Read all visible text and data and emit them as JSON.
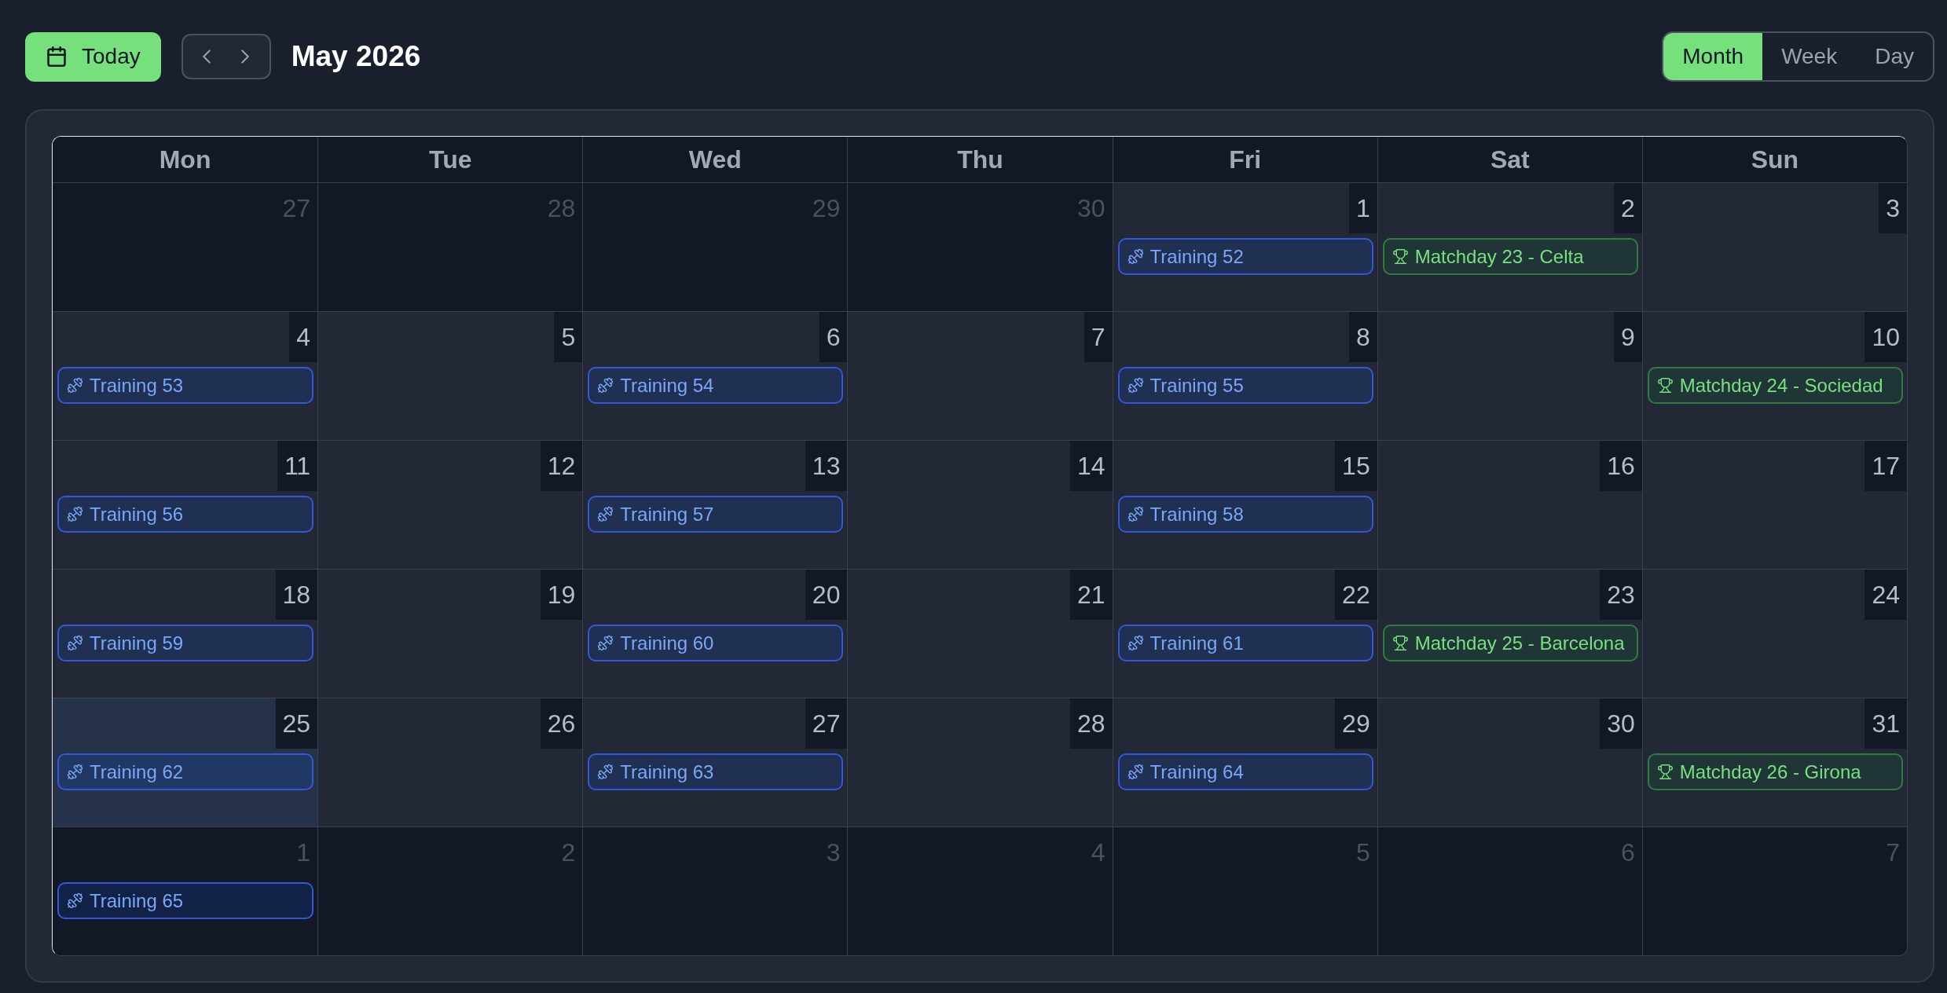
{
  "toolbar": {
    "today_button": "Today",
    "title": "May 2026",
    "views": [
      {
        "label": "Month",
        "selected": true
      },
      {
        "label": "Week",
        "selected": false
      },
      {
        "label": "Day",
        "selected": false
      }
    ]
  },
  "calendar": {
    "weekdays": [
      "Mon",
      "Tue",
      "Wed",
      "Thu",
      "Fri",
      "Sat",
      "Sun"
    ],
    "weeks": [
      {
        "days": [
          {
            "day": "27",
            "in_month": false,
            "today": false
          },
          {
            "day": "28",
            "in_month": false,
            "today": false
          },
          {
            "day": "29",
            "in_month": false,
            "today": false
          },
          {
            "day": "30",
            "in_month": false,
            "today": false
          },
          {
            "day": "1",
            "in_month": true,
            "today": false,
            "events": [
              {
                "kind": "training",
                "title": "Training 52"
              }
            ]
          },
          {
            "day": "2",
            "in_month": true,
            "today": false,
            "events": [
              {
                "kind": "match",
                "title": "Matchday 23 - Celta"
              }
            ]
          },
          {
            "day": "3",
            "in_month": true,
            "today": false
          }
        ]
      },
      {
        "days": [
          {
            "day": "4",
            "in_month": true,
            "today": false,
            "events": [
              {
                "kind": "training",
                "title": "Training 53"
              }
            ]
          },
          {
            "day": "5",
            "in_month": true,
            "today": false
          },
          {
            "day": "6",
            "in_month": true,
            "today": false,
            "events": [
              {
                "kind": "training",
                "title": "Training 54"
              }
            ]
          },
          {
            "day": "7",
            "in_month": true,
            "today": false
          },
          {
            "day": "8",
            "in_month": true,
            "today": false,
            "events": [
              {
                "kind": "training",
                "title": "Training 55"
              }
            ]
          },
          {
            "day": "9",
            "in_month": true,
            "today": false
          },
          {
            "day": "10",
            "in_month": true,
            "today": false,
            "events": [
              {
                "kind": "match",
                "title": "Matchday 24 - Sociedad"
              }
            ]
          }
        ]
      },
      {
        "days": [
          {
            "day": "11",
            "in_month": true,
            "today": false,
            "events": [
              {
                "kind": "training",
                "title": "Training 56"
              }
            ]
          },
          {
            "day": "12",
            "in_month": true,
            "today": false
          },
          {
            "day": "13",
            "in_month": true,
            "today": false,
            "events": [
              {
                "kind": "training",
                "title": "Training 57"
              }
            ]
          },
          {
            "day": "14",
            "in_month": true,
            "today": false
          },
          {
            "day": "15",
            "in_month": true,
            "today": false,
            "events": [
              {
                "kind": "training",
                "title": "Training 58"
              }
            ]
          },
          {
            "day": "16",
            "in_month": true,
            "today": false
          },
          {
            "day": "17",
            "in_month": true,
            "today": false
          }
        ]
      },
      {
        "days": [
          {
            "day": "18",
            "in_month": true,
            "today": false,
            "events": [
              {
                "kind": "training",
                "title": "Training 59"
              }
            ]
          },
          {
            "day": "19",
            "in_month": true,
            "today": false
          },
          {
            "day": "20",
            "in_month": true,
            "today": false,
            "events": [
              {
                "kind": "training",
                "title": "Training 60"
              }
            ]
          },
          {
            "day": "21",
            "in_month": true,
            "today": false
          },
          {
            "day": "22",
            "in_month": true,
            "today": false,
            "events": [
              {
                "kind": "training",
                "title": "Training 61"
              }
            ]
          },
          {
            "day": "23",
            "in_month": true,
            "today": false,
            "events": [
              {
                "kind": "match",
                "title": "Matchday 25 - Barcelona"
              }
            ]
          },
          {
            "day": "24",
            "in_month": true,
            "today": false
          }
        ]
      },
      {
        "days": [
          {
            "day": "25",
            "in_month": true,
            "today": true,
            "events": [
              {
                "kind": "training",
                "title": "Training 62"
              }
            ]
          },
          {
            "day": "26",
            "in_month": true,
            "today": false
          },
          {
            "day": "27",
            "in_month": true,
            "today": false,
            "events": [
              {
                "kind": "training",
                "title": "Training 63"
              }
            ]
          },
          {
            "day": "28",
            "in_month": true,
            "today": false
          },
          {
            "day": "29",
            "in_month": true,
            "today": false,
            "events": [
              {
                "kind": "training",
                "title": "Training 64"
              }
            ]
          },
          {
            "day": "30",
            "in_month": true,
            "today": false
          },
          {
            "day": "31",
            "in_month": true,
            "today": false,
            "events": [
              {
                "kind": "match",
                "title": "Matchday 26 - Girona"
              }
            ]
          }
        ]
      },
      {
        "days": [
          {
            "day": "1",
            "in_month": false,
            "today": false,
            "events": [
              {
                "kind": "training",
                "title": "Training 65"
              }
            ]
          },
          {
            "day": "2",
            "in_month": false,
            "today": false
          },
          {
            "day": "3",
            "in_month": false,
            "today": false
          },
          {
            "day": "4",
            "in_month": false,
            "today": false
          },
          {
            "day": "5",
            "in_month": false,
            "today": false
          },
          {
            "day": "6",
            "in_month": false,
            "today": false
          },
          {
            "day": "7",
            "in_month": false,
            "today": false
          }
        ]
      }
    ]
  }
}
